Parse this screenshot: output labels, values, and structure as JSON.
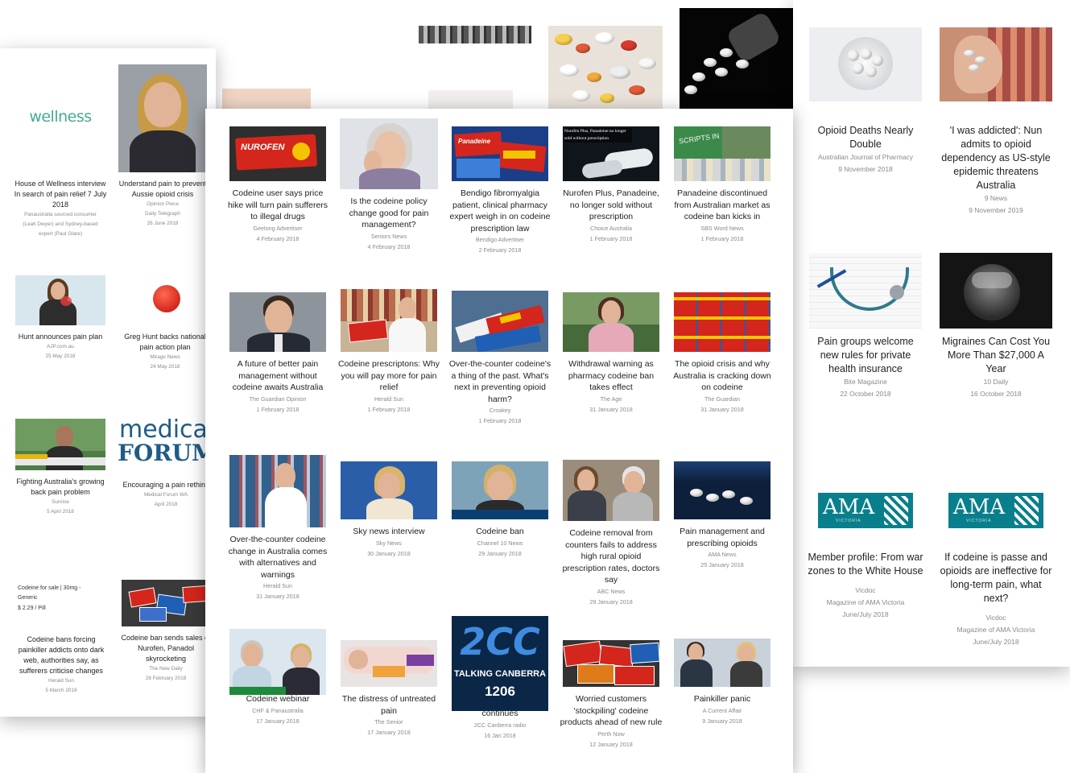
{
  "left_sheet": [
    {
      "title": "House of Wellness interview In search of pain relief 7 July 2018",
      "meta": [
        "Panaustralia sourced consumer",
        "(Leah Dwyer) and Sydney-based",
        "expert (Paul Glare)"
      ],
      "logo": "wellness"
    },
    {
      "title": "Understand pain to prevent Aussie opioid crisis",
      "meta": [
        "Opinion Piece",
        "Daily Telegraph",
        "26 June 2018"
      ]
    },
    {
      "title": "Hunt announces pain plan",
      "meta": [
        "AJP.com.au",
        "25 May 2018"
      ]
    },
    {
      "title": "Greg Hunt backs national pain action plan",
      "meta": [
        "Mirage News",
        "24 May 2018"
      ]
    },
    {
      "title": "Fighting Australia's growing back pain problem",
      "meta": [
        "Sunrise",
        "5 April 2018"
      ]
    },
    {
      "title": "Encouraging a pain rethink",
      "meta": [
        "Medical Forum WA",
        "April 2018"
      ],
      "logo_top": "medica",
      "logo_bottom": "FORUM"
    },
    {
      "title": "Codeine bans forcing painkiller addicts onto dark web, authorities say, as sufferers criticise changes",
      "meta": [
        "Herald Sun",
        "5 March 2018"
      ],
      "thumb_text": [
        "Codeine for sale | 30mg -",
        "Generic",
        "$ 2.29 / Pill"
      ]
    },
    {
      "title": "Codeine ban sends sales of Nurofen, Panadol skyrocketing",
      "meta": [
        "The New Daily",
        "28 February 2018"
      ]
    }
  ],
  "center_sheet": [
    {
      "title": "Codeine user says price hike will turn pain sufferers to illegal drugs",
      "meta": [
        "Geelong Advertiser",
        "4 February 2018"
      ],
      "thumb_text": "NUROFEN"
    },
    {
      "title": "Is the codeine policy change good for pain management?",
      "meta": [
        "Seniors News",
        "4 February 2018"
      ]
    },
    {
      "title": "Bendigo fibromyalgia patient, clinical pharmacy expert weigh in on codeine prescription law",
      "meta": [
        "Bendigo Advertiser",
        "2 February 2018"
      ],
      "thumb_text": "Panadeine"
    },
    {
      "title": "Nurofen Plus, Panadeine, no longer sold without prescription",
      "meta": [
        "Choice Australia",
        "1 February 2018"
      ],
      "thumb_text": "Nurofen Plus, Panadeine no longer sold without prescription"
    },
    {
      "title": "Panadeine discontinued from Australian market as codeine ban kicks in",
      "meta": [
        "SBS Word News",
        "1 February 2018"
      ],
      "thumb_text": "SCRIPTS IN"
    },
    {
      "title": "A future of better pain management without codeine awaits Australia",
      "meta": [
        "The Guardian Opinion",
        "1 February 2018"
      ]
    },
    {
      "title": "Codeine prescriptons: Why you will pay more for pain relief",
      "meta": [
        "Herald Sun",
        "1 February 2018"
      ]
    },
    {
      "title": "Over-the-counter codeine's a thing of the past. What's next in preventing opioid harm?",
      "meta": [
        "Croakey",
        "1 February 2018"
      ]
    },
    {
      "title": "Withdrawal warning as pharmacy codeine ban takes effect",
      "meta": [
        "The Age",
        "31 January 2018"
      ]
    },
    {
      "title": "The opioid crisis and why Australia is cracking down on codeine",
      "meta": [
        "The Guardian",
        "31 January 2018"
      ]
    },
    {
      "title": "Over-the-counter codeine change in Australia comes with alternatives and warnings",
      "meta": [
        "Herald Sun",
        "31 January 2018"
      ]
    },
    {
      "title": "Sky news interview",
      "meta": [
        "Sky News",
        "30 January 2018"
      ]
    },
    {
      "title": "Codeine ban",
      "meta": [
        "Channel 10 News",
        "29 January 2018"
      ]
    },
    {
      "title": "Codeine removal from counters fails to address high rural opioid prescription rates, doctors say",
      "meta": [
        "ABC News",
        "29 January 2018"
      ]
    },
    {
      "title": "Pain management and prescribing opioids",
      "meta": [
        "AMA News",
        "25 January 2018"
      ]
    },
    {
      "title": "Codeine webinar",
      "meta": [
        "CHF & Panaustralia",
        "17 January 2018"
      ]
    },
    {
      "title": "The distress of untreated pain",
      "meta": [
        "The Senior",
        "17 January 2018"
      ]
    },
    {
      "title": "continues",
      "meta": [
        "2CC Canberra radio",
        "16 Jan 2018"
      ],
      "thumb_text": [
        "2CC",
        "TALKING CANBERRA",
        "1206"
      ]
    },
    {
      "title": "Worried customers 'stockpiling' codeine products ahead of new rule",
      "meta": [
        "Perth Now",
        "12 January 2018"
      ]
    },
    {
      "title": "Painkiller panic",
      "meta": [
        "A Current Affair",
        "9 January 2018"
      ]
    }
  ],
  "right_sheet": [
    {
      "title": "Opioid Deaths Nearly Double",
      "meta": [
        "Australian Journal of Pharmacy",
        "9 November 2018"
      ]
    },
    {
      "title": "'I was addicted': Nun admits to opioid dependency as US-style epidemic threatens Australia",
      "meta": [
        "9 News",
        "9 November 2019"
      ]
    },
    {
      "title": "Pain groups welcome new rules for private health insurance",
      "meta": [
        "Bite Magazine",
        "",
        "22 October 2018"
      ]
    },
    {
      "title": "Migraines Can Cost You More Than $27,000 A Year",
      "meta": [
        "10 Daily",
        "",
        "16 October 2018"
      ]
    },
    {
      "title": "Member profile: From war zones to the White House",
      "meta": [
        "Vicdoc",
        "Magazine of AMA Victoria",
        "June/July 2018"
      ],
      "logo": "AMA",
      "logo_sub": "VICTORIA"
    },
    {
      "title": "If codeine is passe and opioids are ineffective for long-term pain, what next?",
      "meta": [
        "Vicdoc",
        "Magazine of AMA Victoria",
        "June/July 2018"
      ],
      "logo": "AMA",
      "logo_sub": "VICTORIA"
    }
  ],
  "colors": {
    "text": "#222222",
    "meta": "#8a8a8a",
    "nurofen_red": "#d4261c",
    "ama_teal": "#0a7f8c",
    "wellness_green": "#46a896",
    "medica_blue": "#1e5c88"
  }
}
